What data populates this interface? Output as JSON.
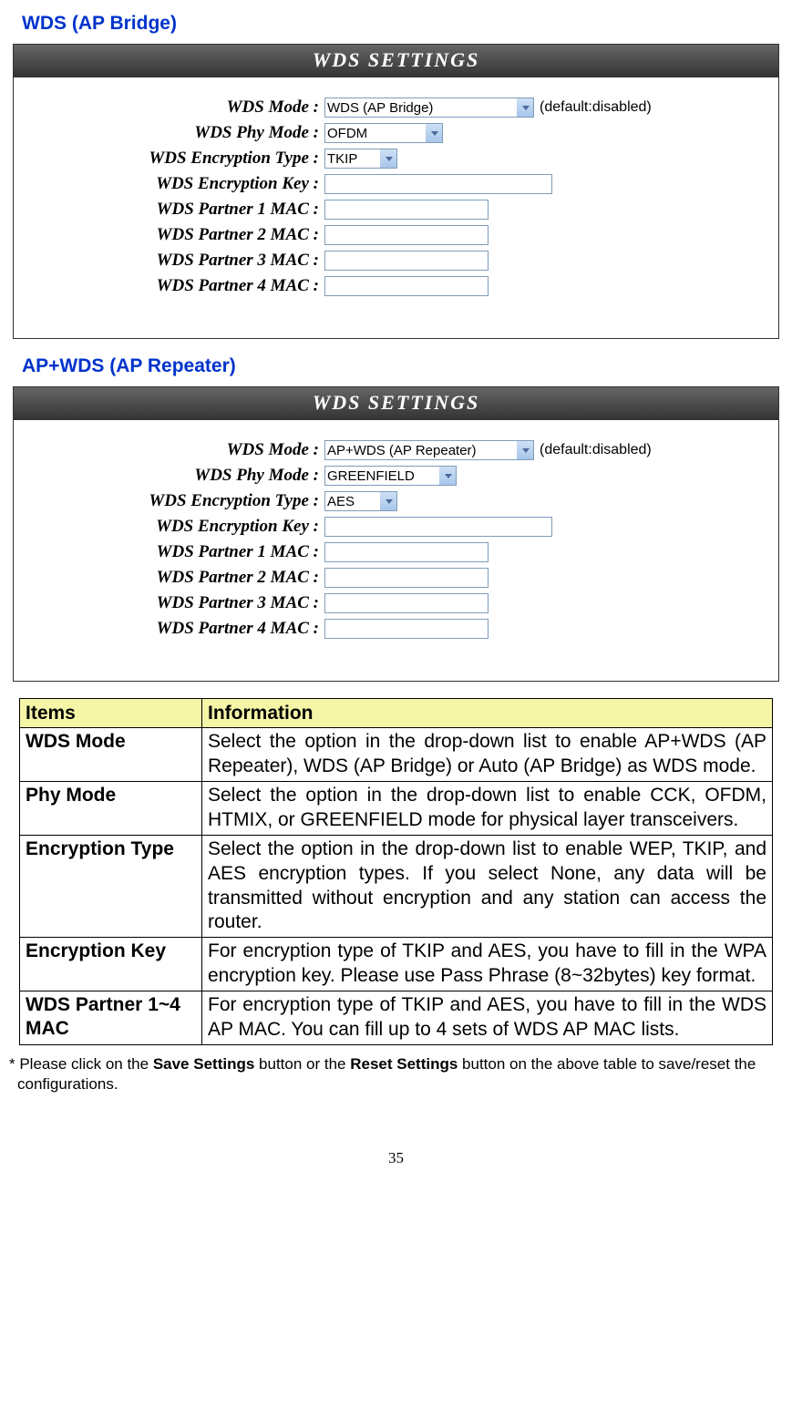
{
  "sec1": {
    "title": "WDS (AP Bridge)",
    "panel_title": "WDS SETTINGS",
    "aux": "(default:disabled)",
    "labels": {
      "mode": "WDS Mode :",
      "phy": "WDS Phy Mode :",
      "enc": "WDS Encryption Type :",
      "key": "WDS Encryption Key :",
      "m1": "WDS Partner 1 MAC :",
      "m2": "WDS Partner 2 MAC :",
      "m3": "WDS Partner 3 MAC :",
      "m4": "WDS Partner 4 MAC :"
    },
    "values": {
      "mode": "WDS (AP Bridge)",
      "phy": "OFDM",
      "enc": "TKIP",
      "key": "",
      "m1": "",
      "m2": "",
      "m3": "",
      "m4": ""
    }
  },
  "sec2": {
    "title": "AP+WDS (AP Repeater)",
    "panel_title": "WDS SETTINGS",
    "aux": "(default:disabled)",
    "labels": {
      "mode": "WDS Mode :",
      "phy": "WDS Phy Mode :",
      "enc": "WDS Encryption Type :",
      "key": "WDS Encryption Key :",
      "m1": "WDS Partner 1 MAC :",
      "m2": "WDS Partner 2 MAC :",
      "m3": "WDS Partner 3 MAC :",
      "m4": "WDS Partner 4 MAC :"
    },
    "values": {
      "mode": "AP+WDS (AP Repeater)",
      "phy": "GREENFIELD",
      "enc": "AES",
      "key": "",
      "m1": "",
      "m2": "",
      "m3": "",
      "m4": ""
    }
  },
  "table": {
    "head": {
      "c1": "Items",
      "c2": "Information"
    },
    "rows": [
      {
        "item": "WDS Mode",
        "info": "Select the option in the drop-down list to enable AP+WDS (AP Repeater), WDS (AP Bridge) or Auto (AP Bridge) as WDS mode."
      },
      {
        "item": "Phy Mode",
        "info": "Select the option in the drop-down list to enable CCK, OFDM, HTMIX, or GREENFIELD mode for physical layer transceivers."
      },
      {
        "item": "Encryption Type",
        "info": "Select the option in the drop-down list to enable WEP, TKIP, and AES encryption types. If you select None, any data will be transmitted without encryption and any station can access the router."
      },
      {
        "item": "Encryption Key",
        "info": "For encryption type of TKIP and AES, you have to fill in the WPA encryption key. Please use Pass Phrase (8~32bytes) key format."
      },
      {
        "item": "WDS Partner 1~4 MAC",
        "info": "For encryption type of TKIP and AES, you have to fill in the WDS AP MAC. You can fill up to 4 sets of WDS AP MAC lists."
      }
    ]
  },
  "footnote": {
    "pre": "* Please click on the ",
    "b1": "Save Settings",
    "mid": " button or the ",
    "b2": "Reset Settings",
    "post": " button on the above table to save/reset the configurations."
  },
  "page_number": "35"
}
